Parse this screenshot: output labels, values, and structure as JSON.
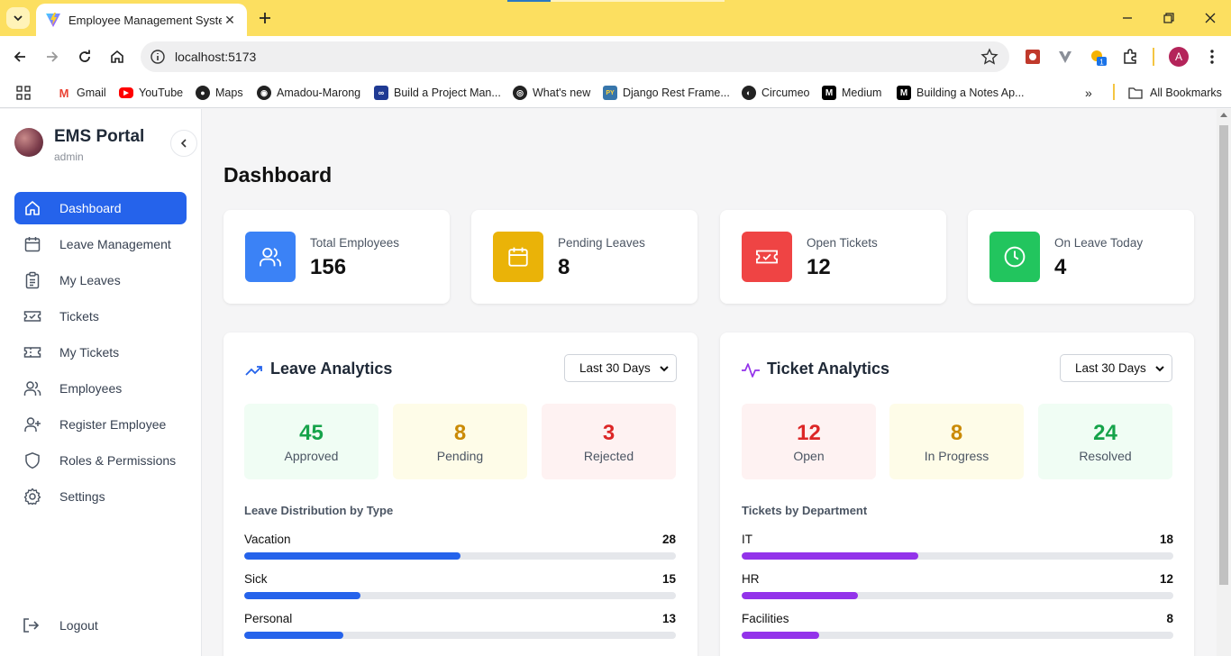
{
  "browser": {
    "tab_title": "Employee Management System",
    "url": "localhost:5173",
    "bookmarks": [
      {
        "label": "Gmail",
        "icon": "gmail-icon"
      },
      {
        "label": "YouTube",
        "icon": "youtube-icon"
      },
      {
        "label": "Maps",
        "icon": "maps-icon"
      },
      {
        "label": "Amadou-Marong",
        "icon": "github-icon"
      },
      {
        "label": "Build a Project Man...",
        "icon": "link-icon"
      },
      {
        "label": "What's new",
        "icon": "chrome-icon"
      },
      {
        "label": "Django Rest Frame...",
        "icon": "python-icon"
      },
      {
        "label": "Circumeo",
        "icon": "globe-icon"
      },
      {
        "label": "Medium",
        "icon": "medium-icon"
      },
      {
        "label": "Building a Notes Ap...",
        "icon": "medium-icon"
      }
    ],
    "all_bookmarks": "All Bookmarks",
    "profile_initial": "A",
    "extension_badge": "1"
  },
  "sidebar": {
    "brand": "EMS Portal",
    "role": "admin",
    "items": [
      {
        "label": "Dashboard",
        "icon": "home-icon",
        "active": true
      },
      {
        "label": "Leave Management",
        "icon": "calendar-icon"
      },
      {
        "label": "My Leaves",
        "icon": "clipboard-icon"
      },
      {
        "label": "Tickets",
        "icon": "ticket-check-icon"
      },
      {
        "label": "My Tickets",
        "icon": "ticket-icon"
      },
      {
        "label": "Employees",
        "icon": "users-icon"
      },
      {
        "label": "Register Employee",
        "icon": "user-plus-icon"
      },
      {
        "label": "Roles & Permissions",
        "icon": "shield-icon"
      },
      {
        "label": "Settings",
        "icon": "gear-icon"
      }
    ],
    "logout": "Logout"
  },
  "main": {
    "title": "Dashboard",
    "stats": [
      {
        "label": "Total Employees",
        "value": "156",
        "color": "#3b82f6",
        "icon": "users-icon"
      },
      {
        "label": "Pending Leaves",
        "value": "8",
        "color": "#eab308",
        "icon": "calendar-icon"
      },
      {
        "label": "Open Tickets",
        "value": "12",
        "color": "#ef4444",
        "icon": "ticket-check-icon"
      },
      {
        "label": "On Leave Today",
        "value": "4",
        "color": "#22c55e",
        "icon": "clock-icon"
      }
    ],
    "leave_analytics": {
      "title": "Leave Analytics",
      "range": "Last 30 Days",
      "summary": [
        {
          "value": "45",
          "label": "Approved",
          "color": "#16a34a",
          "bg": "#f0fdf4"
        },
        {
          "value": "8",
          "label": "Pending",
          "color": "#ca8a04",
          "bg": "#fefce8"
        },
        {
          "value": "3",
          "label": "Rejected",
          "color": "#dc2626",
          "bg": "#fef2f2"
        }
      ],
      "distribution_title": "Leave Distribution by Type",
      "bar_color": "#2563eb",
      "bars": [
        {
          "label": "Vacation",
          "count": "28",
          "fraction": 0.5
        },
        {
          "label": "Sick",
          "count": "15",
          "fraction": 0.27
        },
        {
          "label": "Personal",
          "count": "13",
          "fraction": 0.23
        }
      ]
    },
    "ticket_analytics": {
      "title": "Ticket Analytics",
      "range": "Last 30 Days",
      "summary": [
        {
          "value": "12",
          "label": "Open",
          "color": "#dc2626",
          "bg": "#fef2f2"
        },
        {
          "value": "8",
          "label": "In Progress",
          "color": "#ca8a04",
          "bg": "#fefce8"
        },
        {
          "value": "24",
          "label": "Resolved",
          "color": "#16a34a",
          "bg": "#f0fdf4"
        }
      ],
      "distribution_title": "Tickets by Department",
      "bar_color": "#9333ea",
      "bars": [
        {
          "label": "IT",
          "count": "18",
          "fraction": 0.41
        },
        {
          "label": "HR",
          "count": "12",
          "fraction": 0.27
        },
        {
          "label": "Facilities",
          "count": "8",
          "fraction": 0.18
        }
      ]
    }
  }
}
